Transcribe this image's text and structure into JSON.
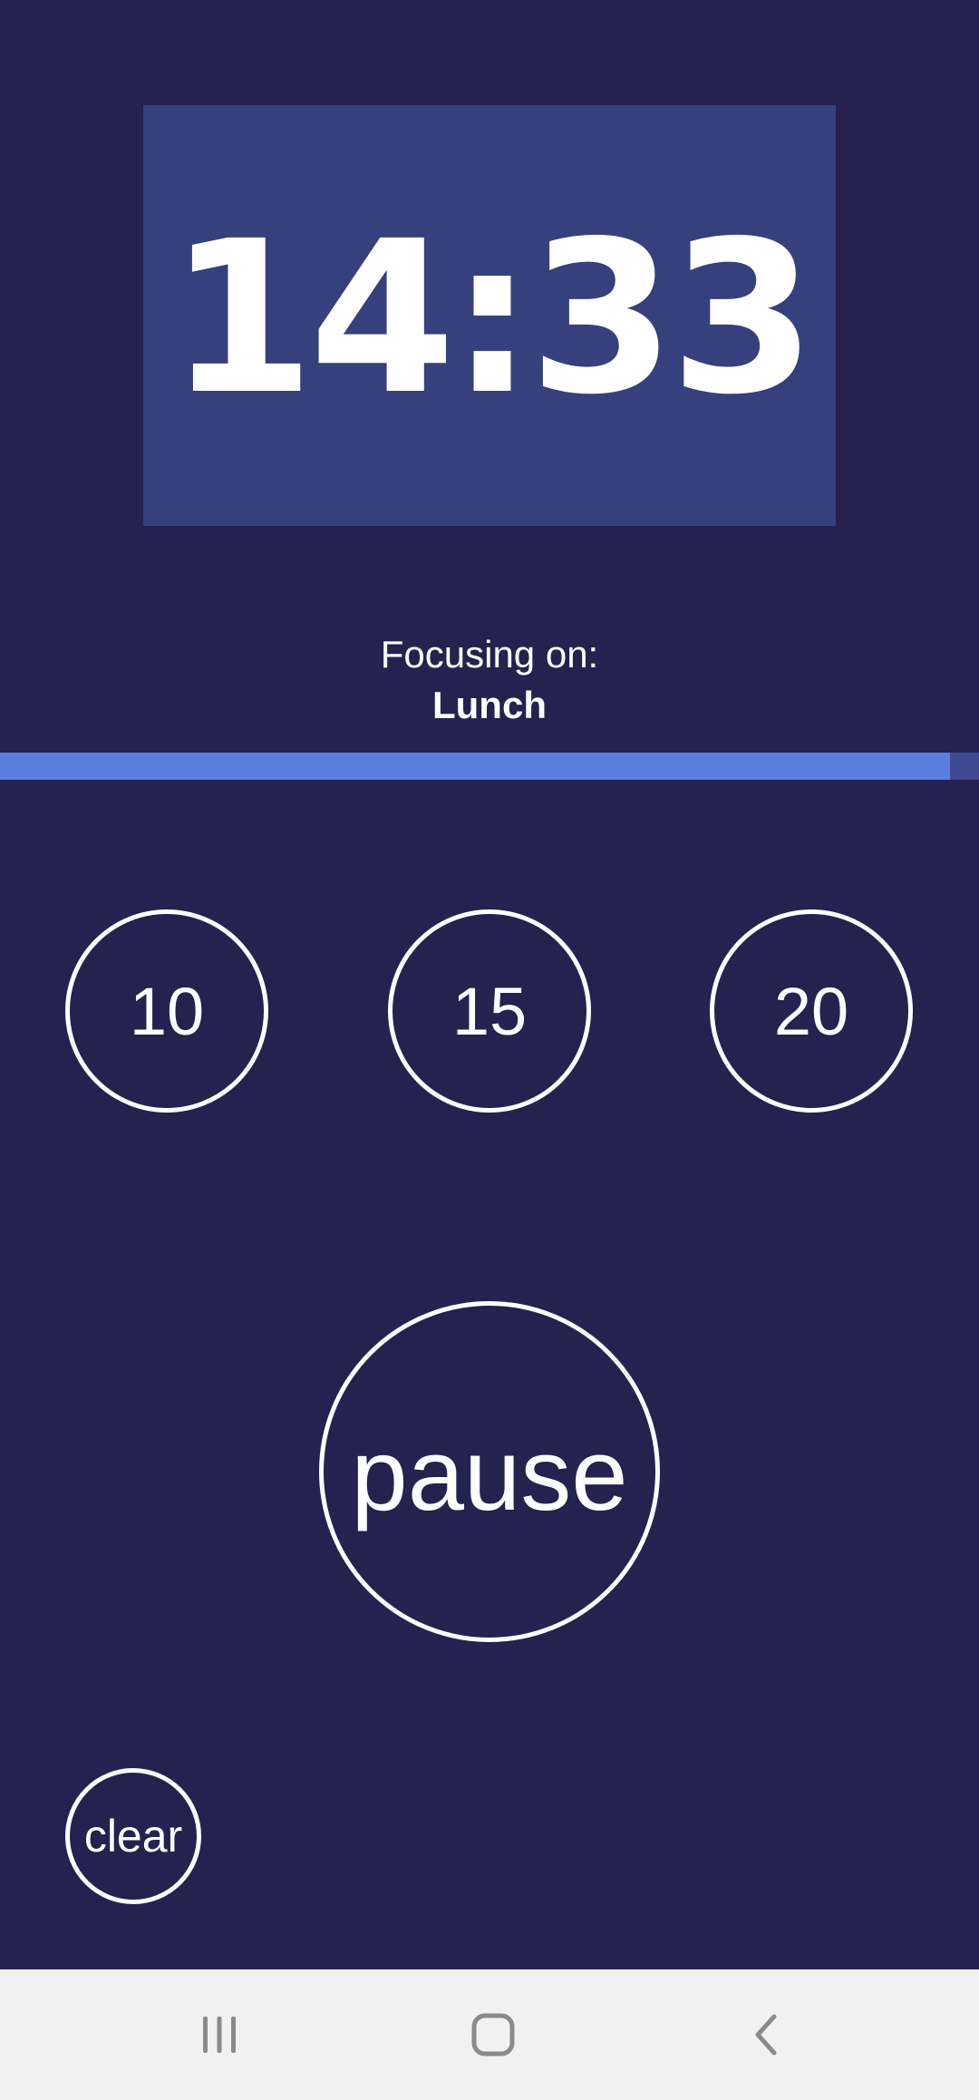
{
  "timer": {
    "display": "14:33"
  },
  "focus": {
    "label": "Focusing on:",
    "task": "Lunch"
  },
  "progress": {
    "fraction": 0.97
  },
  "presets": [
    {
      "label": "10"
    },
    {
      "label": "15"
    },
    {
      "label": "20"
    }
  ],
  "controls": {
    "pause_label": "pause",
    "clear_label": "clear"
  },
  "navbar": {
    "icons": [
      "recents-icon",
      "home-icon",
      "back-icon"
    ]
  },
  "colors": {
    "background": "#25224f",
    "timer_panel": "#36407c",
    "progress_fill": "#5b7fe0",
    "progress_track": "#3f4a93",
    "foreground": "#ffffff",
    "navbar": "#f1f1f1",
    "navbar_icon": "#8a8a8a"
  }
}
